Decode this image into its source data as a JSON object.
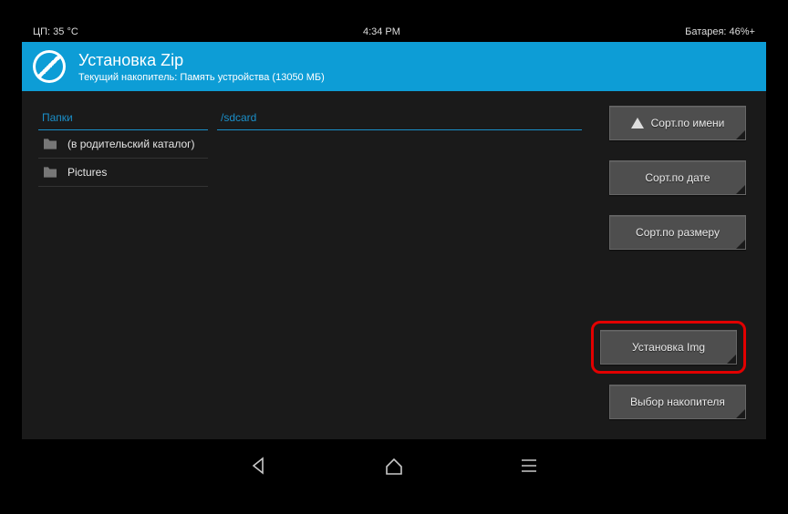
{
  "statusbar": {
    "cpu": "ЦП: 35 °C",
    "time": "4:34 PM",
    "battery": "Батарея: 46%+"
  },
  "header": {
    "title": "Установка Zip",
    "subtitle": "Текущий накопитель: Память устройства (13050 МБ)"
  },
  "folders": {
    "heading": "Папки",
    "items": [
      {
        "label": "(в родительский каталог)"
      },
      {
        "label": "Pictures"
      }
    ]
  },
  "files": {
    "path": "/sdcard"
  },
  "buttons": {
    "sort_name": "Сорт.по имени",
    "sort_date": "Сорт.по дате",
    "sort_size": "Сорт.по размеру",
    "install_img": "Установка Img",
    "select_storage": "Выбор накопителя"
  }
}
